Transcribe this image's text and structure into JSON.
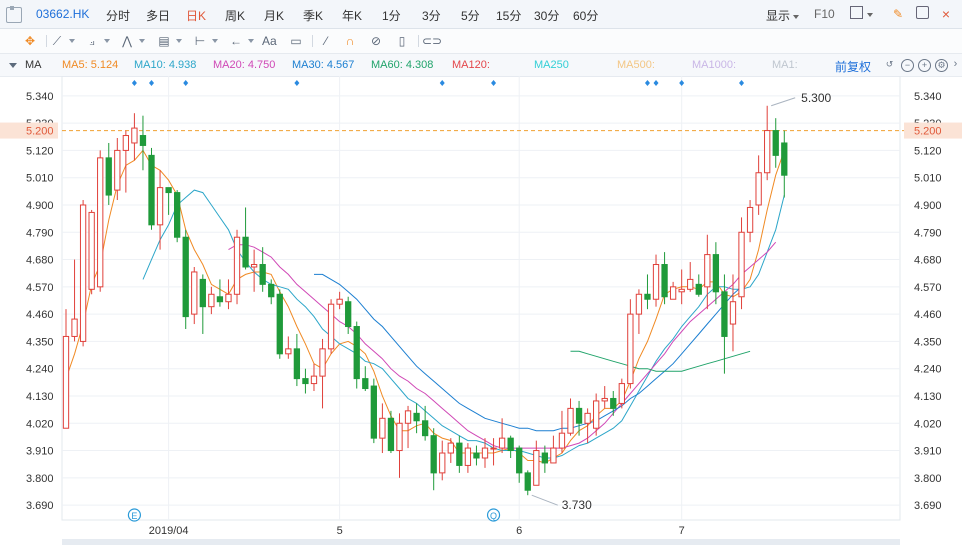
{
  "toolbar": {
    "symbol": "03662.HK",
    "timeframes": [
      "分时",
      "多日",
      "日K",
      "周K",
      "月K",
      "季K",
      "年K",
      "1分",
      "3分",
      "5分",
      "15分",
      "30分",
      "60分"
    ],
    "active_timeframe": "日K",
    "display_label": "显示",
    "f10_label": "F10"
  },
  "drawing_toolbar": {
    "text_tool": "Aa"
  },
  "ma_bar": {
    "label": "MA",
    "items": [
      {
        "text": "MA5: 5.124",
        "color": "#f08a24"
      },
      {
        "text": "MA10: 4.938",
        "color": "#2ca6c9"
      },
      {
        "text": "MA20: 4.750",
        "color": "#d048b6"
      },
      {
        "text": "MA30: 4.567",
        "color": "#1c7fd1"
      },
      {
        "text": "MA60: 4.308",
        "color": "#20a36a"
      },
      {
        "text": "MA120:",
        "color": "#e4454a"
      },
      {
        "text": "MA250",
        "color": "#33cfd6"
      },
      {
        "text": "MA500:",
        "color": "#f3c684"
      },
      {
        "text": "MA1000:",
        "color": "#c9b6e6"
      },
      {
        "text": "MA1:",
        "color": "#bfc6cf"
      }
    ],
    "adjust_label": "前复权"
  },
  "chart_data": {
    "type": "candlestick",
    "y_ticks": [
      "5.340",
      "5.230",
      "5.120",
      "5.010",
      "4.900",
      "4.790",
      "4.680",
      "4.570",
      "4.460",
      "4.350",
      "4.240",
      "4.130",
      "4.020",
      "3.910",
      "3.800",
      "3.690"
    ],
    "ylim": [
      3.63,
      5.42
    ],
    "x_labels": [
      {
        "label": "2019/04",
        "index": 12
      },
      {
        "label": "5",
        "index": 32
      },
      {
        "label": "6",
        "index": 53
      },
      {
        "label": "7",
        "index": 72
      }
    ],
    "current_price_label": "5.200",
    "current_price": 5.2,
    "max_label": "5.300",
    "max_index": 82,
    "min_label": "3.730",
    "min_index": 54,
    "event_markers": [
      {
        "glyph": "E",
        "index": 8
      },
      {
        "glyph": "Q",
        "index": 50
      }
    ],
    "candles": [
      [
        4.0,
        4.37,
        4.48,
        4.01
      ],
      [
        4.37,
        4.44,
        4.68,
        4.35
      ],
      [
        4.35,
        4.9,
        4.92,
        4.33
      ],
      [
        4.56,
        4.87,
        4.88,
        4.54
      ],
      [
        4.57,
        5.09,
        5.12,
        4.55
      ],
      [
        5.09,
        4.94,
        5.15,
        4.9
      ],
      [
        4.96,
        5.12,
        5.17,
        4.92
      ],
      [
        5.12,
        5.18,
        5.2,
        4.95
      ],
      [
        5.15,
        5.21,
        5.27,
        5.08
      ],
      [
        5.18,
        5.14,
        5.26,
        5.04
      ],
      [
        5.1,
        4.82,
        5.13,
        4.8
      ],
      [
        4.82,
        4.97,
        5.04,
        4.72
      ],
      [
        4.97,
        4.95,
        4.97,
        4.86
      ],
      [
        4.95,
        4.77,
        4.96,
        4.75
      ],
      [
        4.77,
        4.45,
        4.8,
        4.4
      ],
      [
        4.46,
        4.63,
        4.65,
        4.42
      ],
      [
        4.6,
        4.49,
        4.62,
        4.38
      ],
      [
        4.49,
        4.54,
        4.57,
        4.46
      ],
      [
        4.53,
        4.51,
        4.6,
        4.49
      ],
      [
        4.51,
        4.54,
        4.6,
        4.48
      ],
      [
        4.54,
        4.77,
        4.8,
        4.5
      ],
      [
        4.77,
        4.65,
        4.89,
        4.64
      ],
      [
        4.65,
        4.66,
        4.72,
        4.55
      ],
      [
        4.66,
        4.58,
        4.73,
        4.55
      ],
      [
        4.58,
        4.53,
        4.6,
        4.5
      ],
      [
        4.54,
        4.3,
        4.56,
        4.28
      ],
      [
        4.3,
        4.32,
        4.37,
        4.28
      ],
      [
        4.32,
        4.2,
        4.38,
        4.17
      ],
      [
        4.2,
        4.18,
        4.24,
        4.14
      ],
      [
        4.18,
        4.21,
        4.26,
        4.15
      ],
      [
        4.21,
        4.32,
        4.36,
        4.08
      ],
      [
        4.32,
        4.5,
        4.52,
        4.3
      ],
      [
        4.5,
        4.52,
        4.55,
        4.48
      ],
      [
        4.51,
        4.41,
        4.53,
        4.38
      ],
      [
        4.41,
        4.2,
        4.43,
        4.16
      ],
      [
        4.2,
        4.16,
        4.25,
        4.15
      ],
      [
        4.17,
        3.96,
        4.2,
        3.94
      ],
      [
        3.96,
        4.04,
        4.1,
        3.9
      ],
      [
        4.04,
        3.91,
        4.07,
        3.9
      ],
      [
        3.91,
        4.02,
        4.06,
        3.8
      ],
      [
        4.02,
        4.07,
        4.09,
        3.92
      ],
      [
        4.06,
        4.03,
        4.1,
        3.98
      ],
      [
        4.03,
        3.97,
        4.09,
        3.95
      ],
      [
        3.97,
        3.82,
        4.0,
        3.75
      ],
      [
        3.82,
        3.9,
        3.95,
        3.79
      ],
      [
        3.9,
        3.94,
        3.96,
        3.86
      ],
      [
        3.94,
        3.85,
        3.97,
        3.82
      ],
      [
        3.85,
        3.92,
        3.94,
        3.82
      ],
      [
        3.9,
        3.88,
        3.93,
        3.85
      ],
      [
        3.88,
        3.92,
        3.96,
        3.84
      ],
      [
        3.92,
        3.92,
        3.96,
        3.85
      ],
      [
        3.92,
        3.96,
        4.04,
        3.9
      ],
      [
        3.96,
        3.91,
        3.97,
        3.88
      ],
      [
        3.92,
        3.82,
        3.93,
        3.78
      ],
      [
        3.82,
        3.75,
        3.83,
        3.73
      ],
      [
        3.77,
        3.91,
        3.95,
        3.77
      ],
      [
        3.9,
        3.86,
        3.93,
        3.82
      ],
      [
        3.86,
        3.92,
        3.97,
        3.86
      ],
      [
        3.92,
        3.98,
        4.07,
        3.9
      ],
      [
        3.98,
        4.08,
        4.12,
        3.97
      ],
      [
        4.08,
        4.02,
        4.11,
        3.97
      ],
      [
        4.02,
        4.06,
        4.08,
        3.94
      ],
      [
        4.0,
        4.11,
        4.14,
        3.97
      ],
      [
        4.11,
        4.12,
        4.17,
        4.08
      ],
      [
        4.12,
        4.08,
        4.15,
        4.05
      ],
      [
        4.1,
        4.18,
        4.2,
        4.08
      ],
      [
        4.18,
        4.46,
        4.52,
        4.16
      ],
      [
        4.46,
        4.54,
        4.56,
        4.38
      ],
      [
        4.54,
        4.52,
        4.62,
        4.48
      ],
      [
        4.52,
        4.66,
        4.7,
        4.49
      ],
      [
        4.66,
        4.53,
        4.71,
        4.5
      ],
      [
        4.52,
        4.57,
        4.59,
        4.52
      ],
      [
        4.55,
        4.56,
        4.64,
        4.5
      ],
      [
        4.56,
        4.6,
        4.67,
        4.55
      ],
      [
        4.58,
        4.54,
        4.62,
        4.53
      ],
      [
        4.57,
        4.7,
        4.78,
        4.48
      ],
      [
        4.7,
        4.55,
        4.75,
        4.5
      ],
      [
        4.55,
        4.37,
        4.62,
        4.22
      ],
      [
        4.42,
        4.51,
        4.62,
        4.31
      ],
      [
        4.53,
        4.79,
        4.85,
        4.48
      ],
      [
        4.79,
        4.89,
        4.92,
        4.75
      ],
      [
        4.9,
        5.03,
        5.1,
        4.86
      ],
      [
        5.03,
        5.2,
        5.3,
        5.0
      ],
      [
        5.2,
        5.1,
        5.25,
        5.05
      ],
      [
        5.15,
        5.02,
        5.2,
        4.93
      ]
    ],
    "ma": {
      "MA5": {
        "color": "#f08a24",
        "values": [
          4.2,
          4.3,
          4.42,
          4.58,
          4.66,
          4.84,
          4.98,
          5.06,
          5.08,
          5.12,
          5.06,
          5.04,
          5.0,
          4.94,
          4.8,
          4.72,
          4.66,
          4.58,
          4.56,
          4.54,
          4.6,
          4.62,
          4.63,
          4.63,
          4.62,
          4.55,
          4.49,
          4.41,
          4.34,
          4.26,
          4.24,
          4.3,
          4.34,
          4.35,
          4.33,
          4.3,
          4.23,
          4.13,
          4.05,
          3.99,
          3.99,
          4.01,
          4.02,
          3.98,
          3.96,
          3.95,
          3.9,
          3.9,
          3.9,
          3.9,
          3.9,
          3.91,
          3.92,
          3.9,
          3.87,
          3.87,
          3.86,
          3.88,
          3.9,
          3.95,
          3.99,
          4.01,
          4.05,
          4.08,
          4.08,
          4.11,
          4.19,
          4.28,
          4.35,
          4.44,
          4.54,
          4.56,
          4.57,
          4.57,
          4.56,
          4.59,
          4.59,
          4.54,
          4.53,
          4.55,
          4.6,
          4.72,
          4.88,
          5.02,
          5.12
        ]
      },
      "MA10": {
        "color": "#2ca6c9",
        "values": [
          null,
          null,
          null,
          null,
          null,
          null,
          null,
          null,
          null,
          4.6,
          4.68,
          4.76,
          4.82,
          4.9,
          4.93,
          4.96,
          4.95,
          4.9,
          4.85,
          4.8,
          4.72,
          4.67,
          4.63,
          4.6,
          4.58,
          4.57,
          4.56,
          4.52,
          4.49,
          4.45,
          4.4,
          4.37,
          4.34,
          4.32,
          4.3,
          4.27,
          4.26,
          4.24,
          4.2,
          4.16,
          4.12,
          4.1,
          4.07,
          4.04,
          4.01,
          3.99,
          3.97,
          3.95,
          3.95,
          3.94,
          3.92,
          3.91,
          3.91,
          3.91,
          3.9,
          3.89,
          3.88,
          3.88,
          3.89,
          3.91,
          3.93,
          3.94,
          3.96,
          3.98,
          4.0,
          4.03,
          4.09,
          4.15,
          4.21,
          4.27,
          4.32,
          4.36,
          4.41,
          4.45,
          4.49,
          4.54,
          4.57,
          4.57,
          4.56,
          4.56,
          4.57,
          4.62,
          4.71,
          4.8,
          4.94
        ]
      },
      "MA20": {
        "color": "#d048b6",
        "values": [
          null,
          null,
          null,
          null,
          null,
          null,
          null,
          null,
          null,
          null,
          null,
          null,
          null,
          null,
          null,
          null,
          null,
          null,
          null,
          4.72,
          4.74,
          4.74,
          4.73,
          4.71,
          4.69,
          4.65,
          4.62,
          4.58,
          4.55,
          4.52,
          4.49,
          4.46,
          4.43,
          4.41,
          4.38,
          4.34,
          4.31,
          4.28,
          4.24,
          4.21,
          4.19,
          4.16,
          4.14,
          4.11,
          4.08,
          4.05,
          4.02,
          3.99,
          3.97,
          3.95,
          3.93,
          3.92,
          3.92,
          3.92,
          3.92,
          3.92,
          3.92,
          3.92,
          3.92,
          3.93,
          3.94,
          3.96,
          3.99,
          4.02,
          4.06,
          4.1,
          4.14,
          4.18,
          4.22,
          4.26,
          4.3,
          4.35,
          4.39,
          4.43,
          4.46,
          4.49,
          4.52,
          4.55,
          4.58,
          4.62,
          4.65,
          4.68,
          4.71,
          4.75
        ]
      },
      "MA30": {
        "color": "#1c7fd1",
        "values": [
          null,
          null,
          null,
          null,
          null,
          null,
          null,
          null,
          null,
          null,
          null,
          null,
          null,
          null,
          null,
          null,
          null,
          null,
          null,
          null,
          null,
          null,
          null,
          null,
          null,
          null,
          null,
          null,
          null,
          4.62,
          4.62,
          4.6,
          4.58,
          4.55,
          4.52,
          4.48,
          4.44,
          4.41,
          4.37,
          4.33,
          4.29,
          4.25,
          4.22,
          4.19,
          4.16,
          4.13,
          4.1,
          4.08,
          4.06,
          4.04,
          4.03,
          4.02,
          4.01,
          4.0,
          4.0,
          3.99,
          3.99,
          3.99,
          4.0,
          4.0,
          4.01,
          4.02,
          4.03,
          4.05,
          4.07,
          4.09,
          4.12,
          4.14,
          4.17,
          4.2,
          4.23,
          4.26,
          4.3,
          4.34,
          4.38,
          4.42,
          4.46,
          4.5,
          4.54,
          4.57
        ]
      },
      "MA60": {
        "color": "#20a36a",
        "values": [
          null,
          null,
          null,
          null,
          null,
          null,
          null,
          null,
          null,
          null,
          null,
          null,
          null,
          null,
          null,
          null,
          null,
          null,
          null,
          null,
          null,
          null,
          null,
          null,
          null,
          null,
          null,
          null,
          null,
          null,
          null,
          null,
          null,
          null,
          null,
          null,
          null,
          null,
          null,
          null,
          null,
          null,
          null,
          null,
          null,
          null,
          null,
          null,
          null,
          null,
          null,
          null,
          null,
          null,
          null,
          null,
          null,
          null,
          null,
          4.31,
          4.31,
          4.3,
          4.29,
          4.28,
          4.27,
          4.26,
          4.25,
          4.24,
          4.24,
          4.23,
          4.23,
          4.23,
          4.23,
          4.24,
          4.25,
          4.26,
          4.27,
          4.28,
          4.29,
          4.3,
          4.31
        ]
      }
    }
  }
}
